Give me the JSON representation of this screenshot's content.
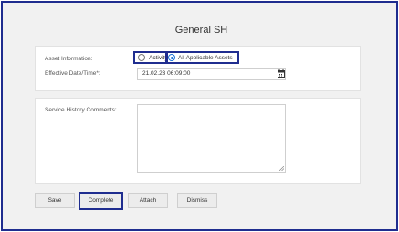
{
  "title": "General SH",
  "asset_information": {
    "label": "Asset Information:",
    "options": [
      {
        "label": "Activity",
        "checked": false
      },
      {
        "label": "All Applicable Assets",
        "checked": true
      }
    ]
  },
  "effective_date": {
    "label": "Effective Date/Time*:",
    "value": "21.02.23 06:09:00",
    "icon": "calendar-icon"
  },
  "comments": {
    "label": "Service History Comments:",
    "value": ""
  },
  "buttons": {
    "save": "Save",
    "complete": "Complete",
    "attach": "Attach",
    "dismiss": "Dismiss"
  },
  "colors": {
    "highlight": "#1f2d8f",
    "radio_accent": "#1a6fd6"
  }
}
